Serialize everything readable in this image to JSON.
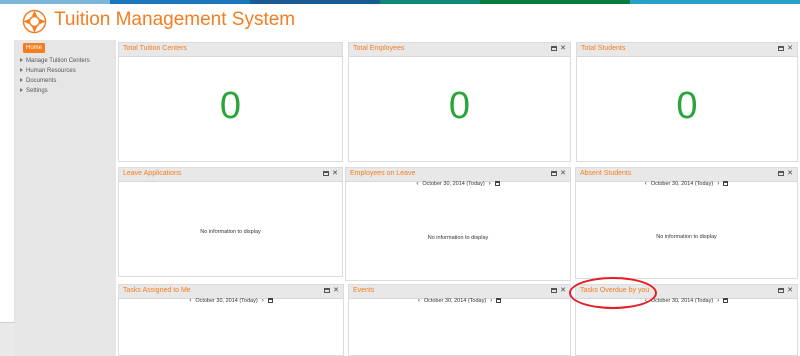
{
  "app": {
    "title": "Tuition Management System"
  },
  "colors": {
    "accent": "#f47d20",
    "number": "#2aa53a",
    "topbar": [
      "#79b6d9",
      "#1a75b8",
      "#1a5b94",
      "#12887a",
      "#0a7a3d",
      "#27a0c8"
    ]
  },
  "sidebar": {
    "home_label": "Home",
    "items": [
      {
        "label": "Manage Tuition Centers"
      },
      {
        "label": "Human Resources"
      },
      {
        "label": "Documents"
      },
      {
        "label": "Settings"
      }
    ]
  },
  "panels": {
    "tuition_centers": {
      "title": "Total Tuition Centers",
      "value": "0"
    },
    "employees": {
      "title": "Total Employees",
      "value": "0"
    },
    "students": {
      "title": "Total Students",
      "value": "0"
    },
    "leave_applications": {
      "title": "Leave Applications",
      "empty": "No information to display"
    },
    "employees_on_leave": {
      "title": "Employees on Leave",
      "date": "October 30, 2014 (Today)",
      "empty": "No information to display"
    },
    "absent_students": {
      "title": "Absent Students",
      "date": "October 30, 2014 (Today)",
      "empty": "No information to display"
    },
    "tasks_assigned": {
      "title": "Tasks Assigned to Me",
      "date": "October 30, 2014 (Today)"
    },
    "events": {
      "title": "Events",
      "date": "October 30, 2014 (Today)"
    },
    "tasks_overdue": {
      "title": "Tasks Overdue by you",
      "date": "October 30, 2014 (Today)"
    }
  }
}
